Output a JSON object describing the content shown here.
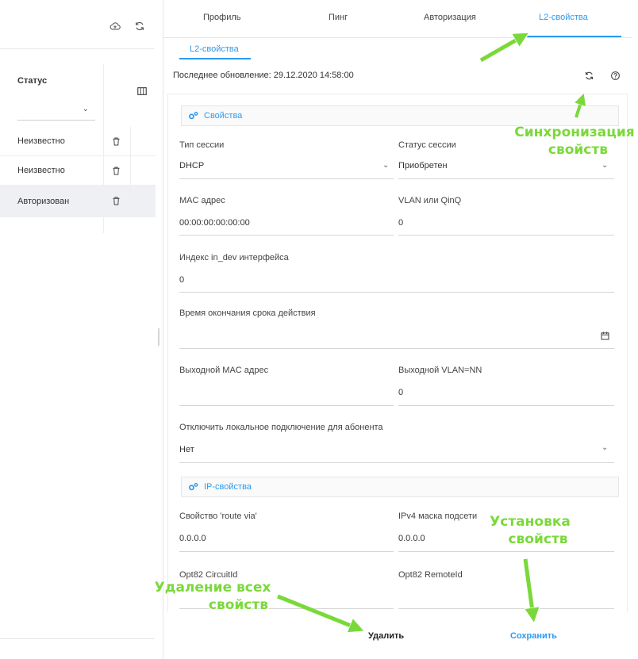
{
  "left_panel": {
    "toolbar": {
      "add_icon": "cloud-add-icon",
      "refresh_icon": "refresh-icon"
    },
    "status_column": {
      "label": "Статус",
      "filter_value": ""
    },
    "columns_icon": "columns-icon",
    "rows": [
      {
        "status": "Неизвестно",
        "active": false
      },
      {
        "status": "Неизвестно",
        "active": false
      },
      {
        "status": "Авторизован",
        "active": true
      }
    ]
  },
  "tabs": [
    {
      "label": "Профиль",
      "active": false
    },
    {
      "label": "Пинг",
      "active": false
    },
    {
      "label": "Авторизация",
      "active": false
    },
    {
      "label": "L2-свойства",
      "active": true
    }
  ],
  "subtab": {
    "label": "L2-свойства"
  },
  "header": {
    "last_update": "Последнее обновление: 29.12.2020 14:58:00",
    "sync_icon": "refresh-icon",
    "help_icon": "help-icon"
  },
  "sections": {
    "properties": {
      "title": "Свойства"
    },
    "ip_properties": {
      "title": "IP-свойства"
    }
  },
  "fields": {
    "session_type": {
      "label": "Тип сессии",
      "value": "DHCP"
    },
    "session_status": {
      "label": "Статус сессии",
      "value": "Приобретен"
    },
    "mac_address": {
      "label": "MAC адрес",
      "value": "00:00:00:00:00:00"
    },
    "vlan_qinq": {
      "label": "VLAN или QinQ",
      "value": "0"
    },
    "in_dev_index": {
      "label": "Индекс in_dev интерфейса",
      "value": "0"
    },
    "expiry_time": {
      "label": "Время окончания срока действия",
      "value": ""
    },
    "out_mac": {
      "label": "Выходной MAC адрес",
      "value": ""
    },
    "out_vlan": {
      "label": "Выходной VLAN=NN",
      "value": "0"
    },
    "disable_local": {
      "label": "Отключить локальное подключение для абонента",
      "value": "Нет"
    },
    "route_via": {
      "label": "Свойство 'route via'",
      "value": "0.0.0.0"
    },
    "ipv4_mask": {
      "label": "IPv4 маска подсети",
      "value": "0.0.0.0"
    },
    "opt82_circuit": {
      "label": "Opt82 CircuitId",
      "value": ""
    },
    "opt82_remote": {
      "label": "Opt82 RemoteId",
      "value": ""
    }
  },
  "footer": {
    "delete_label": "Удалить",
    "save_label": "Сохранить"
  },
  "annotations": {
    "sync": [
      "Синхронизация",
      "свойств"
    ],
    "set": [
      "Установка",
      "свойств"
    ],
    "delete_all": [
      "Удаление всех",
      "свойств"
    ],
    "color": "#7ad93a"
  },
  "colors": {
    "accent": "#2c9af0",
    "active_row": "#eef0f4"
  }
}
